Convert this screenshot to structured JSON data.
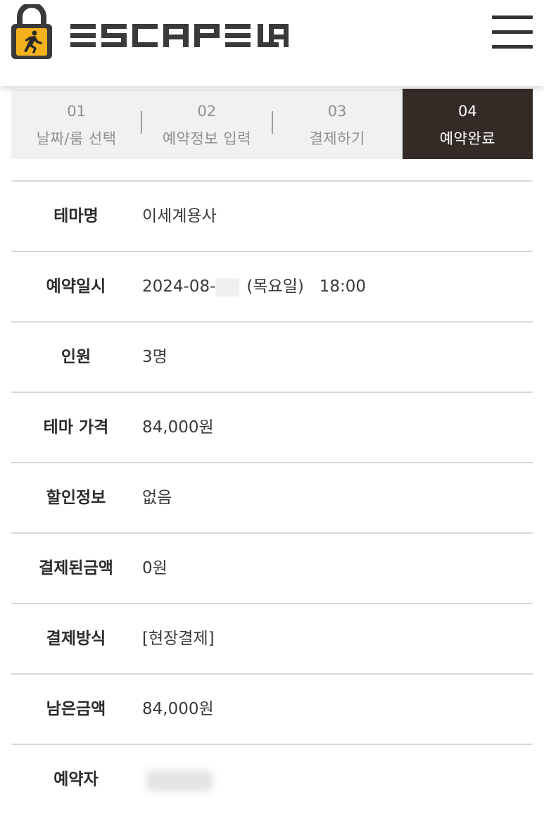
{
  "brand": {
    "name": "ESCAPE LAB"
  },
  "colors": {
    "accent": "#f5b21c",
    "dark": "#342b27",
    "divider": "#d9d9d9"
  },
  "steps": [
    {
      "num": "01",
      "label": "날짜/룸 선택",
      "active": false
    },
    {
      "num": "02",
      "label": "예약정보 입력",
      "active": false
    },
    {
      "num": "03",
      "label": "결제하기",
      "active": false
    },
    {
      "num": "04",
      "label": "예약완료",
      "active": true
    }
  ],
  "details": {
    "theme_name": {
      "label": "테마명",
      "value": "이세계용사"
    },
    "datetime": {
      "label": "예약일시",
      "date_prefix": "2024-08-",
      "weekday": "(목요일)",
      "time": "18:00"
    },
    "people": {
      "label": "인원",
      "value": "3명"
    },
    "theme_price": {
      "label": "테마 가격",
      "value": "84,000원"
    },
    "discount": {
      "label": "할인정보",
      "value": "없음"
    },
    "paid_amount": {
      "label": "결제된금액",
      "value": "0원"
    },
    "payment_method": {
      "label": "결제방식",
      "value": "[현장결제]"
    },
    "remaining": {
      "label": "남은금액",
      "value": "84,000원"
    },
    "booker": {
      "label": "예약자"
    }
  },
  "icons": {
    "logo": "padlock-runner-icon",
    "menu": "hamburger-menu-icon"
  }
}
